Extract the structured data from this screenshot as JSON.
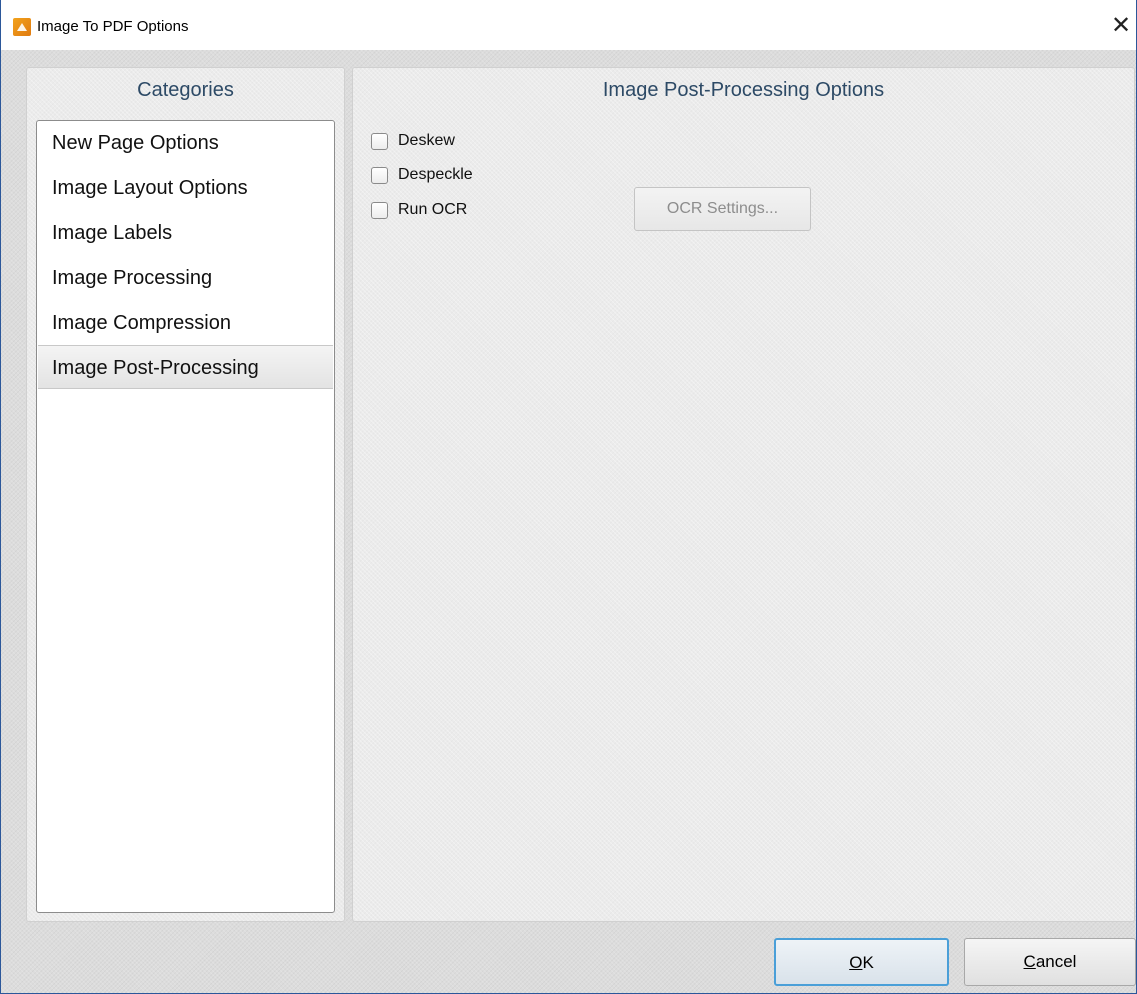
{
  "window": {
    "title": "Image To PDF Options",
    "app_icon": "pdf-xchange-icon",
    "close_glyph": "✕"
  },
  "categories": {
    "header": "Categories",
    "items": [
      {
        "label": "New Page Options",
        "selected": false
      },
      {
        "label": "Image Layout Options",
        "selected": false
      },
      {
        "label": "Image Labels",
        "selected": false
      },
      {
        "label": "Image Processing",
        "selected": false
      },
      {
        "label": "Image Compression",
        "selected": false
      },
      {
        "label": "Image Post-Processing",
        "selected": true
      }
    ]
  },
  "options": {
    "header": "Image Post-Processing Options",
    "checkboxes": [
      {
        "label": "Deskew",
        "checked": false
      },
      {
        "label": "Despeckle",
        "checked": false
      },
      {
        "label": "Run OCR",
        "checked": false
      }
    ],
    "ocr_settings_label": "OCR Settings...",
    "ocr_settings_enabled": false
  },
  "footer": {
    "ok_label": "OK",
    "ok_accel": "O",
    "ok_rest": "K",
    "cancel_label": "Cancel",
    "cancel_accel": "C",
    "cancel_rest": "ancel"
  },
  "colors": {
    "header_text": "#2d4a66",
    "ok_border": "#4a9fd8",
    "app_icon": "#f2a21c"
  }
}
